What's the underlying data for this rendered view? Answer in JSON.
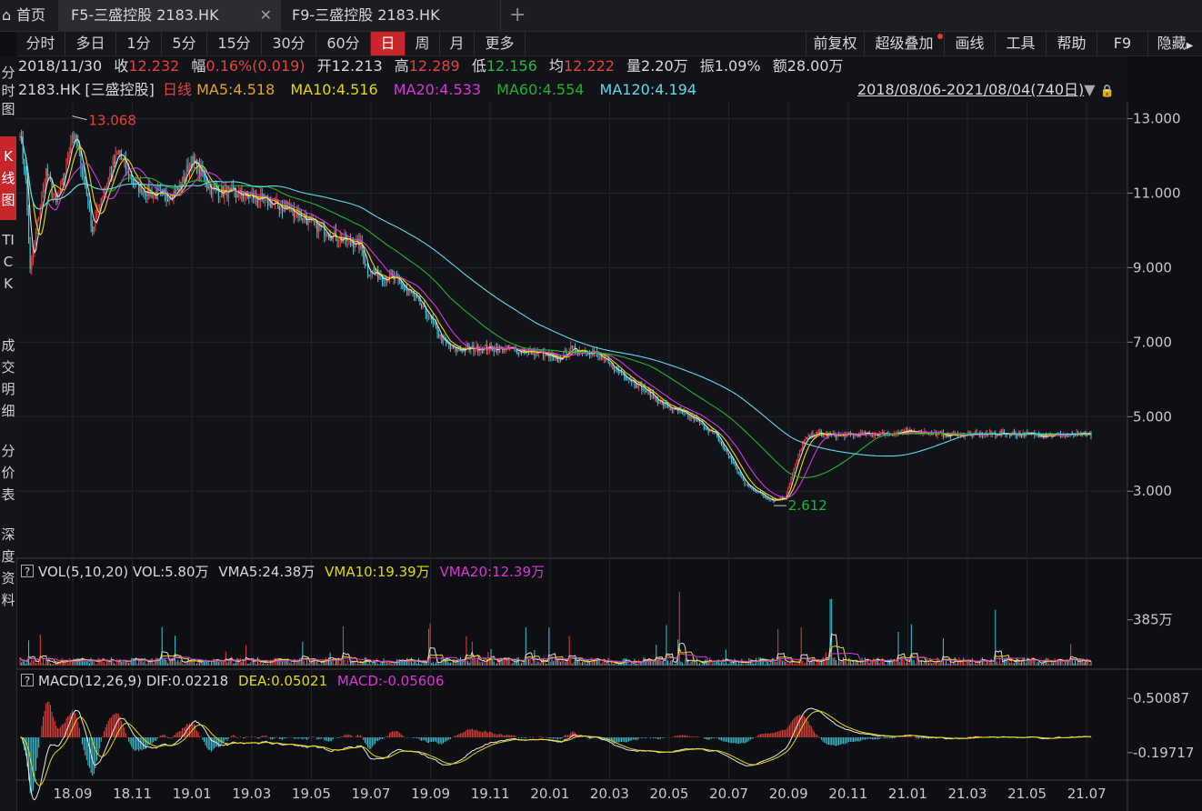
{
  "tabs": {
    "home_label": "首页",
    "home_icon": "home-icon",
    "tab1_label": "F5-三盛控股 2183.HK",
    "tab2_label": "F9-三盛控股 2183.HK",
    "close_glyph": "✕",
    "add_glyph": "+"
  },
  "toolbar": {
    "periods": [
      "分时",
      "多日",
      "1分",
      "5分",
      "15分",
      "30分",
      "60分",
      "日",
      "周",
      "月",
      "更多"
    ],
    "active_period": "日",
    "right_items": [
      "前复权",
      "超级叠加",
      "画线",
      "工具",
      "帮助",
      "F9",
      "隐藏"
    ],
    "hide_arrow": "▶"
  },
  "left_nav": [
    "分时图",
    "K线图",
    "TICK",
    "成交明细",
    "分价表",
    "深度资料"
  ],
  "active_left_nav": "K线图",
  "quote": {
    "date": "2018/11/30",
    "close_label": "收",
    "close": "12.232",
    "change_label": "幅",
    "change": "0.16%(0.019)",
    "open_label": "开",
    "open": "12.213",
    "high_label": "高",
    "high": "12.289",
    "low_label": "低",
    "low": "12.156",
    "avg_label": "均",
    "avg": "12.222",
    "vol_label": "量",
    "vol": "2.20万",
    "amp_label": "振",
    "amp": "1.09%",
    "amt_label": "额",
    "amt": "28.00万"
  },
  "ma_line": {
    "symbol": "2183.HK [三盛控股]",
    "period": "日线",
    "ma5": "MA5:4.518",
    "ma10": "MA10:4.516",
    "ma20": "MA20:4.533",
    "ma60": "MA60:4.554",
    "ma120": "MA120:4.194",
    "range": "2018/08/06-2021/08/04(740日)",
    "range_arrow": "▼",
    "lock_icon": "lock-icon"
  },
  "vol_legend": {
    "q": "?",
    "name": "VOL(5,10,20)",
    "vol": "VOL:5.80万",
    "vma5": "VMA5:24.38万",
    "vma10": "VMA10:19.39万",
    "vma20": "VMA20:12.39万"
  },
  "macd_legend": {
    "q": "?",
    "name": "MACD(12,26,9)",
    "dif": "DIF:0.02218",
    "dea": "DEA:0.05021",
    "macd": "MACD:-0.05606"
  },
  "colors": {
    "up": "#e8413b",
    "down": "#40c4d8",
    "ma5": "#e0e0e0",
    "ma10": "#e8d800",
    "ma20": "#d836d8",
    "ma60": "#1fb32d",
    "ma120": "#60d8e8",
    "active": "#c8262b"
  },
  "chart_data": {
    "type": "candlestick",
    "x_tick_labels": [
      "18.09",
      "18.11",
      "19.01",
      "19.03",
      "19.05",
      "19.07",
      "19.09",
      "19.11",
      "20.01",
      "20.03",
      "20.05",
      "20.07",
      "20.09",
      "20.11",
      "21.01",
      "21.03",
      "21.05",
      "21.07"
    ],
    "price_axis_ticks": [
      "13.000",
      "11.000",
      "9.000",
      "7.000",
      "5.000",
      "3.000"
    ],
    "price_ticks_values": [
      13,
      11,
      9,
      7,
      5,
      3
    ],
    "price_range": [
      1.2,
      13.45
    ],
    "high_marker": "13.068",
    "low_marker": "2.612",
    "close_path": [
      [
        0,
        12.7
      ],
      [
        4,
        11.3
      ],
      [
        7,
        8.9
      ],
      [
        12,
        10.2
      ],
      [
        18,
        11.6
      ],
      [
        25,
        10.7
      ],
      [
        30,
        11.4
      ],
      [
        36,
        12.6
      ],
      [
        40,
        12.2
      ],
      [
        46,
        11.0
      ],
      [
        50,
        10.0
      ],
      [
        56,
        10.9
      ],
      [
        62,
        11.5
      ],
      [
        68,
        12.1
      ],
      [
        74,
        11.6
      ],
      [
        80,
        11.2
      ],
      [
        90,
        11.0
      ],
      [
        100,
        10.9
      ],
      [
        110,
        11.1
      ],
      [
        118,
        11.9
      ],
      [
        124,
        11.6
      ],
      [
        132,
        11.1
      ],
      [
        145,
        11.0
      ],
      [
        160,
        10.9
      ],
      [
        175,
        10.7
      ],
      [
        190,
        10.5
      ],
      [
        205,
        10.1
      ],
      [
        220,
        9.8
      ],
      [
        235,
        9.6
      ],
      [
        240,
        8.9
      ],
      [
        248,
        8.8
      ],
      [
        258,
        8.7
      ],
      [
        270,
        8.3
      ],
      [
        282,
        7.7
      ],
      [
        292,
        7.0
      ],
      [
        300,
        6.8
      ],
      [
        320,
        6.85
      ],
      [
        340,
        6.8
      ],
      [
        360,
        6.7
      ],
      [
        370,
        6.5
      ],
      [
        380,
        6.8
      ],
      [
        395,
        6.75
      ],
      [
        410,
        6.3
      ],
      [
        425,
        5.9
      ],
      [
        445,
        5.3
      ],
      [
        465,
        4.95
      ],
      [
        480,
        4.5
      ],
      [
        490,
        3.9
      ],
      [
        500,
        3.2
      ],
      [
        512,
        2.9
      ],
      [
        520,
        2.75
      ],
      [
        528,
        2.85
      ],
      [
        534,
        3.6
      ],
      [
        540,
        4.3
      ],
      [
        548,
        4.55
      ],
      [
        560,
        4.5
      ],
      [
        580,
        4.52
      ],
      [
        600,
        4.55
      ],
      [
        620,
        4.6
      ],
      [
        640,
        4.5
      ],
      [
        660,
        4.52
      ],
      [
        680,
        4.55
      ],
      [
        700,
        4.52
      ],
      [
        720,
        4.5
      ],
      [
        739,
        4.52
      ]
    ],
    "ma_latest": {
      "MA5": 4.518,
      "MA10": 4.516,
      "MA20": 4.533,
      "MA60": 4.554,
      "MA120": 4.194
    },
    "volume_axis_tick": "385万",
    "volume_axis_value": 385,
    "macd_axis_ticks": [
      "0.50087",
      "-0.19717"
    ],
    "macd_axis_values": [
      0.50087,
      -0.19717
    ],
    "macd_latest": {
      "DIF": 0.02218,
      "DEA": 0.05021,
      "MACD": -0.05606
    }
  }
}
